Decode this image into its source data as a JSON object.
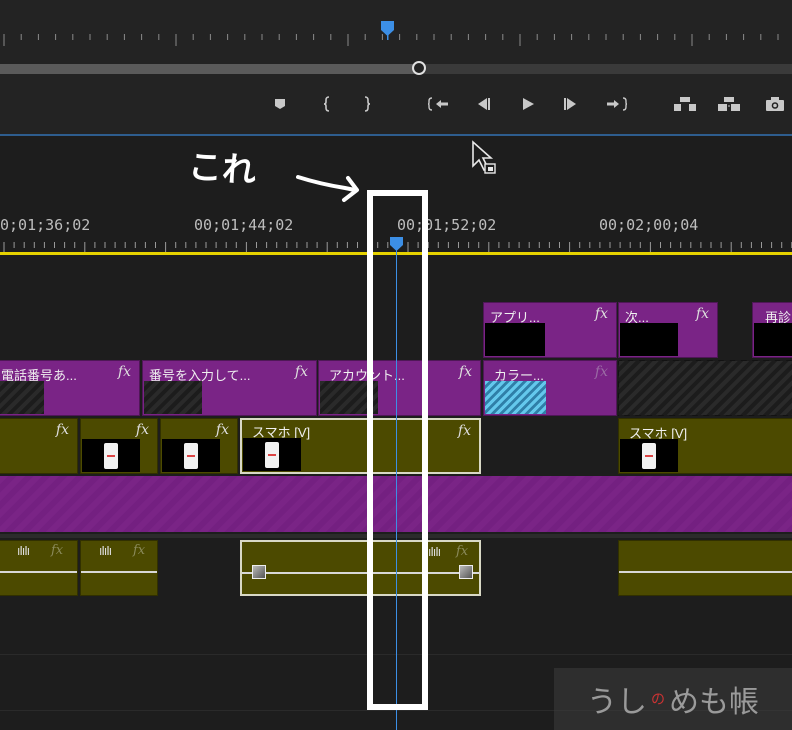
{
  "monitor": {
    "transport_controls": [
      {
        "name": "add-marker-button",
        "glyph": "⬟"
      },
      {
        "name": "mark-in-button",
        "glyph": "{"
      },
      {
        "name": "mark-out-button",
        "glyph": "}"
      },
      {
        "name": "go-to-in-button",
        "glyph": "{⬅"
      },
      {
        "name": "step-back-button",
        "glyph": "◀▏"
      },
      {
        "name": "play-button",
        "glyph": "▶"
      },
      {
        "name": "step-forward-button",
        "glyph": "▕▶"
      },
      {
        "name": "go-to-out-button",
        "glyph": "➡}"
      },
      {
        "name": "lift-button",
        "glyph": "▙▟"
      },
      {
        "name": "extract-button",
        "glyph": "▟▙"
      },
      {
        "name": "export-frame-button",
        "glyph": "📷"
      }
    ]
  },
  "timeline": {
    "annotation": "これ",
    "timecodes": [
      "0;01;36;02",
      "00;01;44;02",
      "00;01;52;02",
      "00;02;00;04"
    ],
    "clips": {
      "v3": [
        {
          "label": "アプリ...",
          "fx": "fx"
        },
        {
          "label": "次...",
          "fx": "fx"
        },
        {
          "label": "再診",
          "fx": ""
        }
      ],
      "v2": [
        {
          "label": "電話番号あ...",
          "fx": "fx"
        },
        {
          "label": "番号を入力して...",
          "fx": "fx"
        },
        {
          "label": "アカウント...",
          "fx": "fx"
        },
        {
          "label": "カラー...",
          "fx": "fx"
        }
      ],
      "v1": [
        {
          "label": "",
          "fx": "fx"
        },
        {
          "label": "",
          "fx": "fx"
        },
        {
          "label": "",
          "fx": "fx"
        },
        {
          "label": "スマホ [V]",
          "fx": "fx"
        },
        {
          "label": "スマホ [V]",
          "fx": ""
        }
      ],
      "a1": [
        {
          "fx": "fx"
        },
        {
          "fx": "fx"
        },
        {
          "fx": "fx"
        }
      ]
    }
  },
  "watermark": {
    "part1": "うし",
    "part2": "の",
    "part3": "めも帳"
  },
  "colors": {
    "accent": "#3c8fe6",
    "work_area": "#e6d200",
    "video_clip": "#7a2486",
    "audio_clip": "#4c4a00"
  }
}
